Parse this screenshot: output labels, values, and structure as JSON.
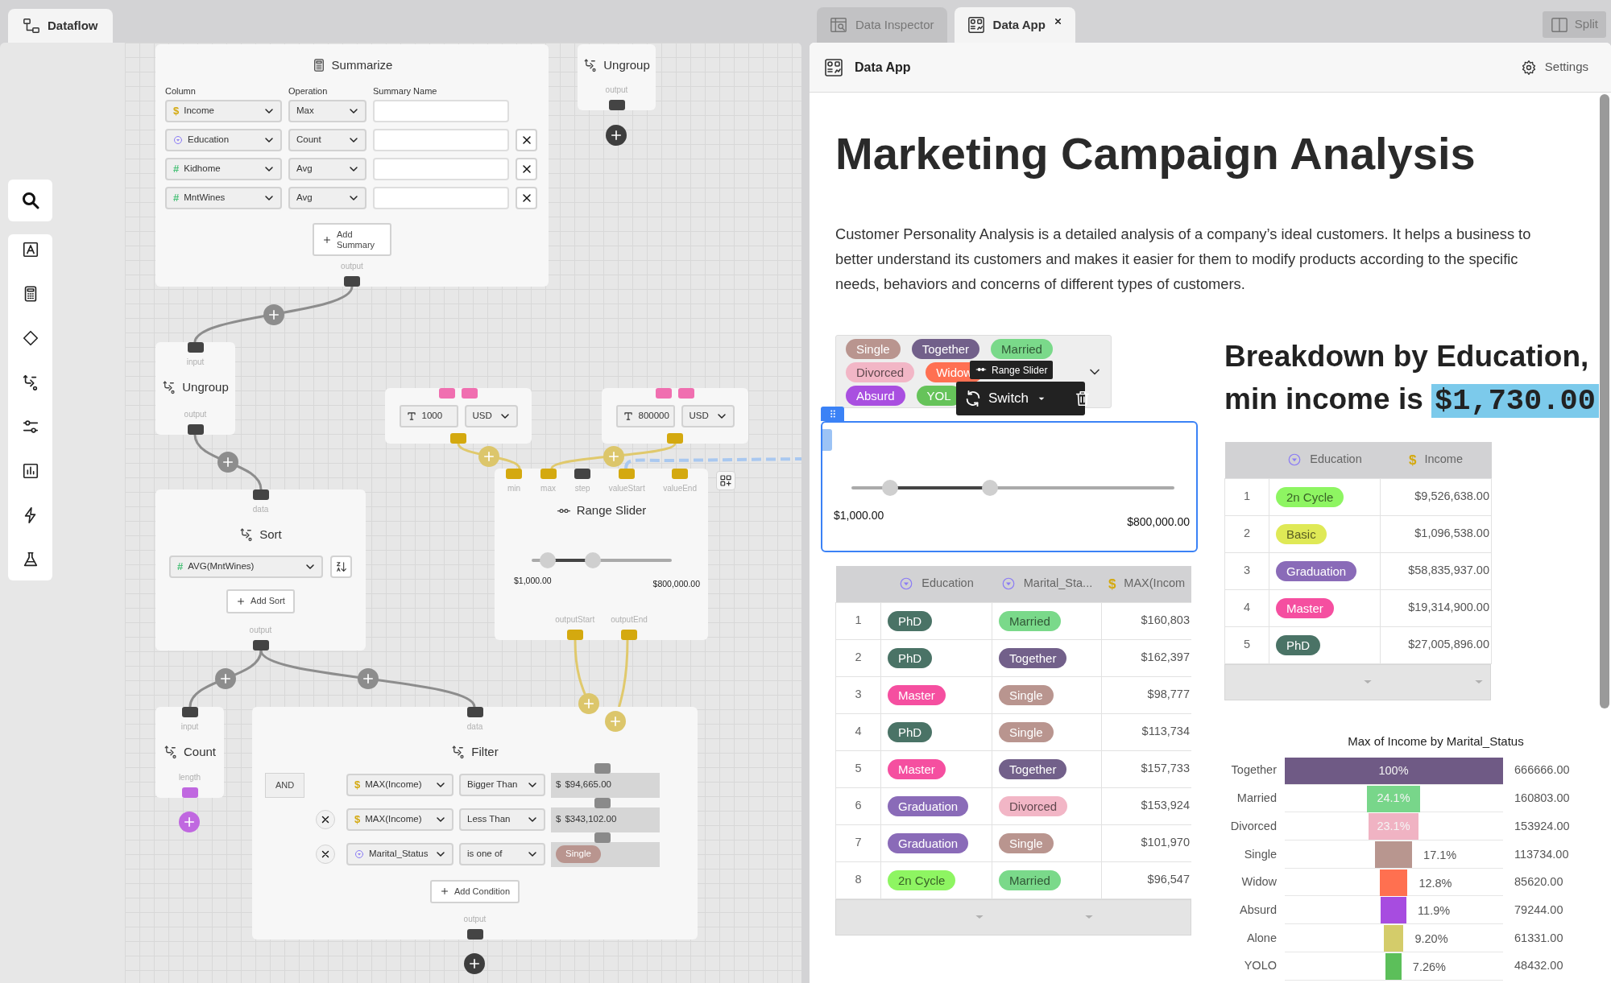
{
  "dataflow_tab": {
    "label": "Dataflow",
    "selected": true
  },
  "summarize": {
    "title": "Summarize",
    "column_header": "Column",
    "operation_header": "Operation",
    "name_header": "Summary Name",
    "rows": [
      {
        "column": "Income",
        "kind": "currency",
        "symbol": "$",
        "operation": "Max",
        "removable": false
      },
      {
        "column": "Education",
        "kind": "category",
        "operation": "Count",
        "removable": true
      },
      {
        "column": "Kidhome",
        "kind": "number",
        "symbol": "#",
        "operation": "Avg",
        "removable": true
      },
      {
        "column": "MntWines",
        "kind": "number",
        "symbol": "#",
        "operation": "Avg",
        "removable": true
      }
    ],
    "add_button": "Add Summary",
    "output_label": "output"
  },
  "ungroup_top": {
    "title": "Ungroup",
    "output_label": "output"
  },
  "ungroup": {
    "title": "Ungroup",
    "input_label": "input",
    "output_label": "output"
  },
  "sort": {
    "title": "Sort",
    "input_label": "data",
    "column": "AVG(MntWines)",
    "kind": "number",
    "symbol": "#",
    "add_button": "Add Sort",
    "output_label": "output"
  },
  "count": {
    "title": "Count",
    "input_label": "input",
    "output_label": "length"
  },
  "filter": {
    "title": "Filter",
    "input_label": "data",
    "logic": "AND",
    "conditions": [
      {
        "column": "MAX(Income)",
        "kind": "currency",
        "symbol": "$",
        "operator": "Bigger Than",
        "value_symbol": "$",
        "value": "$94,665.00",
        "removable": false
      },
      {
        "column": "MAX(Income)",
        "kind": "currency",
        "symbol": "$",
        "operator": "Less Than",
        "value_symbol": "$",
        "value": "$343,102.00",
        "removable": true
      },
      {
        "column": "Marital_Status",
        "kind": "category",
        "operator": "is one of",
        "tags": [
          {
            "label": "Single",
            "color": "#b9958f"
          }
        ],
        "removable": true
      }
    ],
    "add_button": "Add Condition",
    "output_label": "output"
  },
  "value_nodes": [
    {
      "value": "1000",
      "currency": "USD"
    },
    {
      "value": "800000",
      "currency": "USD"
    }
  ],
  "range_slider_node": {
    "title": "Range Slider",
    "inputs": [
      {
        "label": "min",
        "color": "#d4a90f"
      },
      {
        "label": "max",
        "color": "#d4a90f"
      },
      {
        "label": "step",
        "color": "#444444"
      },
      {
        "label": "valueStart",
        "color": "#d4a90f"
      },
      {
        "label": "valueEnd",
        "color": "#d4a90f"
      }
    ],
    "thumbs": [
      {
        "level": 0.12
      },
      {
        "level": 0.44
      }
    ],
    "min_label": "$1,000.00",
    "max_label": "$800,000.00",
    "outputs": [
      {
        "label": "outputStart",
        "color": "#d4a90f"
      },
      {
        "label": "outputEnd",
        "color": "#d4a90f"
      }
    ]
  },
  "tabs": [
    {
      "label": "Data Inspector",
      "kind": "inspector",
      "selected": false,
      "closable": false
    },
    {
      "label": "Data App",
      "kind": "app",
      "selected": true,
      "closable": true
    }
  ],
  "split_button": "Split",
  "app_header": {
    "title": "Data App",
    "settings": "Settings"
  },
  "title": "Marketing Campaign Analysis",
  "description": "Customer Personality Analysis is a detailed analysis of a company’s ideal customers. It helps a business to better understand its customers and makes it easier for them to modify products according to the specific needs, behaviors and concerns of different types of customers.",
  "tag_select": {
    "rows": [
      [
        {
          "label": "Single",
          "color": "#b9958f"
        },
        {
          "label": "Together",
          "color": "#72608a"
        },
        {
          "label": "Married",
          "color": "#7ad98a"
        }
      ],
      [
        {
          "label": "Divorced",
          "color": "#f2b6c6"
        },
        {
          "label": "Widow",
          "color": "#ff7052"
        }
      ],
      [
        {
          "label": "Absurd",
          "color": "#a94fe0"
        },
        {
          "label": "YOL",
          "color": "#66c35a"
        }
      ]
    ]
  },
  "widget_toolbar": {
    "tooltip": "Range Slider",
    "switch": "Switch"
  },
  "range_slider": {
    "thumbs": [
      {
        "level": 0.12
      },
      {
        "level": 0.43
      }
    ],
    "min_label": "$1,000.00",
    "max_label": "$800,000.00"
  },
  "table": {
    "columns": [
      {
        "label": "Education",
        "kind": "category",
        "footer_caret": true
      },
      {
        "label": "Marital_Sta...",
        "kind": "category",
        "footer_caret": true
      },
      {
        "label": "MAX(Incom",
        "kind": "currency",
        "symbol": "$",
        "footer_caret": false
      }
    ],
    "rows": [
      {
        "index": "1",
        "cells": [
          {
            "label": "PhD",
            "color": "#4a7366"
          },
          {
            "label": "Married",
            "color": "#7ad98a"
          },
          {
            "text": "$160,803"
          }
        ]
      },
      {
        "index": "2",
        "cells": [
          {
            "label": "PhD",
            "color": "#4a7366"
          },
          {
            "label": "Together",
            "color": "#72608a"
          },
          {
            "text": "$162,397"
          }
        ]
      },
      {
        "index": "3",
        "cells": [
          {
            "label": "Master",
            "color": "#f54fa0"
          },
          {
            "label": "Single",
            "color": "#b9958f"
          },
          {
            "text": "$98,777"
          }
        ]
      },
      {
        "index": "4",
        "cells": [
          {
            "label": "PhD",
            "color": "#4a7366"
          },
          {
            "label": "Single",
            "color": "#b9958f"
          },
          {
            "text": "$113,734"
          }
        ]
      },
      {
        "index": "5",
        "cells": [
          {
            "label": "Master",
            "color": "#f54fa0"
          },
          {
            "label": "Together",
            "color": "#72608a"
          },
          {
            "text": "$157,733"
          }
        ]
      },
      {
        "index": "6",
        "cells": [
          {
            "label": "Graduation",
            "color": "#8a6bb8"
          },
          {
            "label": "Divorced",
            "color": "#f2b6c6"
          },
          {
            "text": "$153,924"
          }
        ]
      },
      {
        "index": "7",
        "cells": [
          {
            "label": "Graduation",
            "color": "#8a6bb8"
          },
          {
            "label": "Single",
            "color": "#b9958f"
          },
          {
            "text": "$101,970"
          }
        ]
      },
      {
        "index": "8",
        "cells": [
          {
            "label": "2n Cycle",
            "color": "#8ef562"
          },
          {
            "label": "Married",
            "color": "#7ad98a"
          },
          {
            "text": "$96,547"
          }
        ]
      }
    ]
  },
  "breakdown": {
    "line1": "Breakdown by Education,",
    "prefix": "min income is",
    "highlight": "$1,730.00"
  },
  "summary_table": {
    "columns": [
      {
        "label": "Education",
        "kind": "category",
        "footer_caret": true
      },
      {
        "label": "Income",
        "kind": "currency",
        "symbol": "$",
        "footer_caret": true
      }
    ],
    "rows": [
      {
        "index": "1",
        "cells": [
          {
            "label": "2n Cycle",
            "color": "#8ef562"
          },
          {
            "text": "$9,526,638.00"
          }
        ]
      },
      {
        "index": "2",
        "cells": [
          {
            "label": "Basic",
            "color": "#dfe956"
          },
          {
            "text": "$1,096,538.00"
          }
        ]
      },
      {
        "index": "3",
        "cells": [
          {
            "label": "Graduation",
            "color": "#8a6bb8"
          },
          {
            "text": "$58,835,937.00"
          }
        ]
      },
      {
        "index": "4",
        "cells": [
          {
            "label": "Master",
            "color": "#f54fa0"
          },
          {
            "text": "$19,314,900.00"
          }
        ]
      },
      {
        "index": "5",
        "cells": [
          {
            "label": "PhD",
            "color": "#4a7366"
          },
          {
            "text": "$27,005,896.00"
          }
        ]
      }
    ]
  },
  "funnel": {
    "title": "Max of Income by Marital_Status",
    "rows": [
      {
        "label": "Together",
        "percent": "100%",
        "value": "666666.00",
        "color": "#6f5a85"
      },
      {
        "label": "Married",
        "percent": "24.1%",
        "value": "160803.00",
        "color": "#78d68a"
      },
      {
        "label": "Divorced",
        "percent": "23.1%",
        "value": "153924.00",
        "color": "#f0b3c3"
      },
      {
        "label": "Single",
        "percent": "17.1%",
        "value": "113734.00",
        "color": "#b8968f"
      },
      {
        "label": "Widow",
        "percent": "12.8%",
        "value": "85620.00",
        "color": "#ff7050"
      },
      {
        "label": "Absurd",
        "percent": "11.9%",
        "value": "79244.00",
        "color": "#a74ce0"
      },
      {
        "label": "Alone",
        "percent": "9.20%",
        "value": "61331.00",
        "color": "#d4cc6a"
      },
      {
        "label": "YOLO",
        "percent": "7.26%",
        "value": "48432.00",
        "color": "#5cbf5a"
      }
    ]
  }
}
